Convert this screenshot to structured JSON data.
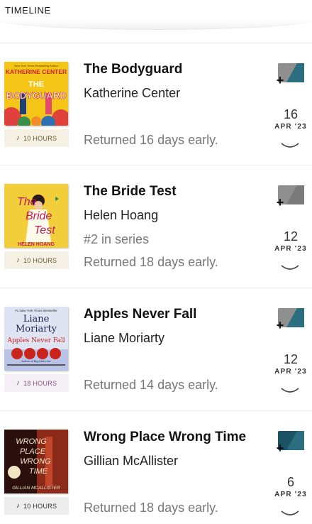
{
  "header": {
    "title": "TIMELINE"
  },
  "colors": {
    "duration_bg_default": "#f5f0e4",
    "duration_fg_default": "#6b5b2a",
    "duration_bg_purple": "#f5f0f5",
    "duration_fg_purple": "#8a4f86",
    "duration_bg_gray": "#ededed",
    "duration_fg_gray": "#333333",
    "tag_gray": "#8f8f8f",
    "tag_teal": "#2a6e80"
  },
  "loans": [
    {
      "title": "The Bodyguard",
      "author": "Katherine Center",
      "series": "",
      "duration": "10 HOURS",
      "returned": "Returned 16 days early.",
      "day": "16",
      "month": "APR '23",
      "cover_text": {
        "top": "New York Times Bestselling Author",
        "author": "KATHERINE CENTER",
        "title_a": "THE",
        "title_b": "BODYGUARD"
      }
    },
    {
      "title": "The Bride Test",
      "author": "Helen Hoang",
      "series": "#2 in series",
      "duration": "10 HOURS",
      "returned": "Returned 18 days early.",
      "day": "12",
      "month": "APR '23",
      "cover_text": {
        "title_a": "The",
        "title_b": "Bride",
        "title_c": "Test",
        "author": "HELEN HOANG"
      }
    },
    {
      "title": "Apples Never Fall",
      "author": "Liane Moriarty",
      "series": "",
      "duration": "18 HOURS",
      "returned": "Returned 14 days early.",
      "day": "12",
      "month": "APR '23",
      "cover_text": {
        "top": "#1 New York Times Bestseller",
        "author_a": "Liane",
        "author_b": "Moriarty",
        "title": "Apples Never Fall",
        "sub": "Author of Big Little Lies"
      }
    },
    {
      "title": "Wrong Place Wrong Time",
      "author": "Gillian McAllister",
      "series": "",
      "duration": "10 HOURS",
      "returned": "Returned 18 days early.",
      "day": "6",
      "month": "APR '23",
      "cover_text": {
        "title_a": "WRONG",
        "title_b": "PLACE",
        "title_c": "WRONG",
        "title_d": "TIME",
        "author": "GILLIAN MCALLISTER"
      }
    }
  ]
}
